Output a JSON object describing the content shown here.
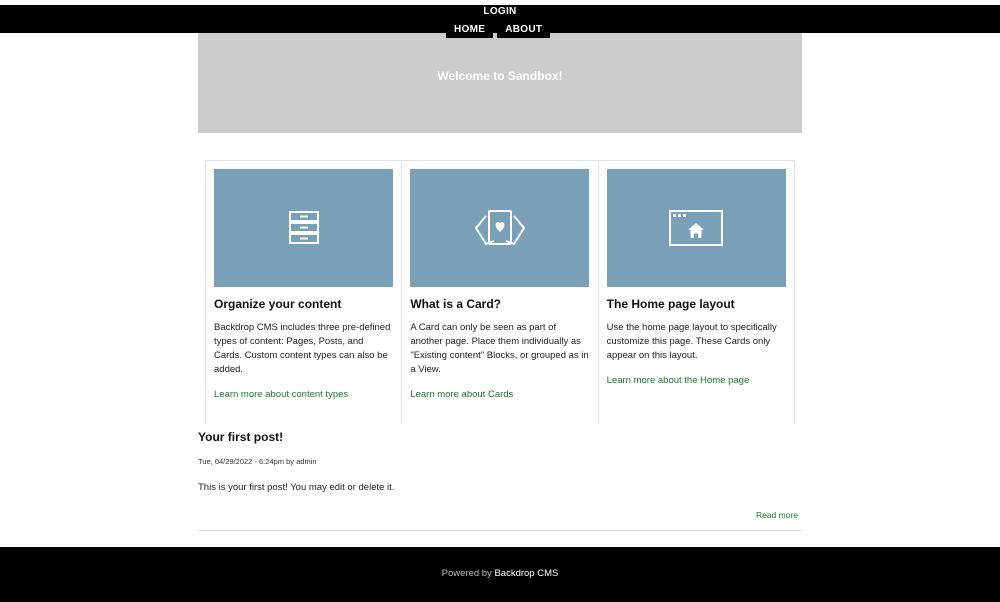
{
  "header": {
    "login_label": "LOGIN",
    "nav": [
      {
        "label": "HOME"
      },
      {
        "label": "ABOUT"
      }
    ]
  },
  "hero": {
    "title": "Welcome to Sandbox!"
  },
  "cards": [
    {
      "icon": "cabinet-icon",
      "title": "Organize your content",
      "text": "Backdrop CMS includes three pre-defined types of content: Pages, Posts, and Cards. Custom content types can also be added.",
      "link": "Learn more about content types"
    },
    {
      "icon": "cards-icon",
      "title": "What is a Card?",
      "text": "A Card can only be seen as part of another page. Place them individually as \"Existing content\" Blocks, or grouped as in a View.",
      "link": "Learn more about Cards"
    },
    {
      "icon": "home-layout-icon",
      "title": "The Home page layout",
      "text": "Use the home page layout to specifically customize this page. These Cards only appear on this layout.",
      "link": "Learn more about the Home page"
    }
  ],
  "post": {
    "title": "Your first post!",
    "meta": "Tue, 04/29/2022 - 6:24pm by admin",
    "body": "This is your first post! You may edit or delete it.",
    "read_more": "Read more"
  },
  "footer": {
    "powered_prefix": "Powered by ",
    "powered_link": "Backdrop CMS"
  },
  "colors": {
    "header_bg": "#000000",
    "hero_bg": "#cccccc",
    "card_image_bg": "#7aa0b8",
    "link": "#1a7a2e"
  }
}
